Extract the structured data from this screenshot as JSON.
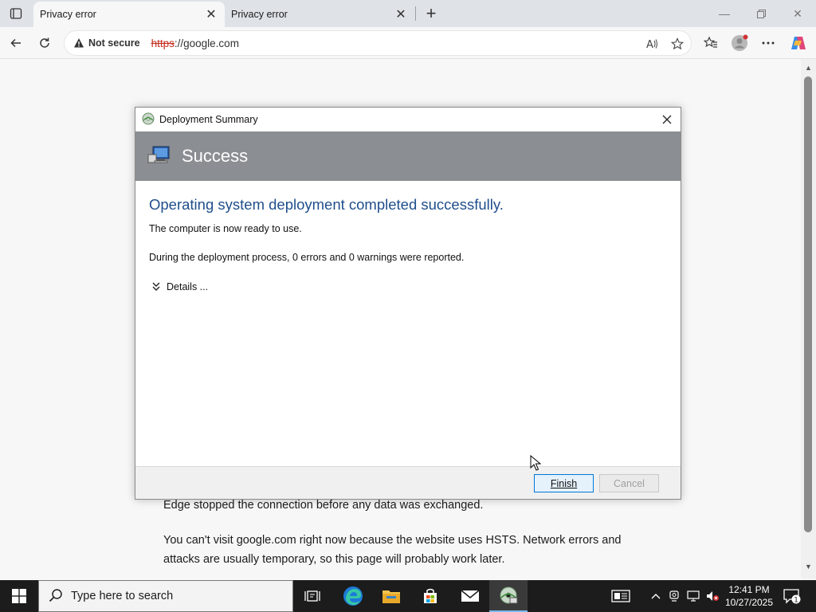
{
  "browser": {
    "tabs": [
      {
        "title": "Privacy error",
        "active": true
      },
      {
        "title": "Privacy error",
        "active": false
      }
    ],
    "address": {
      "security_label": "Not secure",
      "url_scheme": "https",
      "url_rest": "://google.com"
    },
    "read_aloud_label": "A⁵"
  },
  "page": {
    "paragraph1": "Edge stopped the connection before any data was exchanged.",
    "paragraph2_line1": "You can't visit google.com right now because the website uses HSTS. Network errors and",
    "paragraph2_line2": "attacks are usually temporary, so this page will probably work later."
  },
  "dialog": {
    "title": "Deployment Summary",
    "banner_title": "Success",
    "heading": "Operating system deployment completed successfully.",
    "line1": "The computer is now ready to use.",
    "line2": "During the deployment process, 0 errors and 0 warnings were reported.",
    "details_label": "Details ...",
    "finish_label": "Finish",
    "cancel_label": "Cancel",
    "colors": {
      "banner": "#8b8e92",
      "heading": "#1f4e8c"
    }
  },
  "taskbar": {
    "search_placeholder": "Type here to search",
    "time": "12:41 PM",
    "date": "10/27/2025",
    "notification_count": "1",
    "apps": [
      "task-view-icon",
      "edge-icon",
      "file-explorer-icon",
      "store-icon",
      "mail-icon",
      "deployment-wizard-icon"
    ]
  }
}
